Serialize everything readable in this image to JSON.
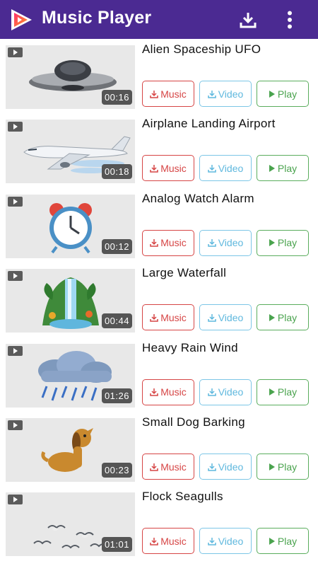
{
  "app": {
    "title": "Music Player"
  },
  "actions": {
    "music_label": "Music",
    "video_label": "Video",
    "play_label": "Play"
  },
  "items": [
    {
      "name": "Alien Spaceship UFO",
      "duration": "00:16",
      "art": "ufo"
    },
    {
      "name": "Airplane Landing Airport",
      "duration": "00:18",
      "art": "airplane"
    },
    {
      "name": "Analog Watch Alarm",
      "duration": "00:12",
      "art": "alarm-clock"
    },
    {
      "name": "Large Waterfall",
      "duration": "00:44",
      "art": "waterfall"
    },
    {
      "name": "Heavy Rain Wind",
      "duration": "01:26",
      "art": "rain-cloud"
    },
    {
      "name": "Small Dog Barking",
      "duration": "00:23",
      "art": "dog"
    },
    {
      "name": "Flock Seagulls",
      "duration": "01:01",
      "art": "seagulls"
    }
  ],
  "colors": {
    "appbar": "#4b2a92",
    "music": "#d64545",
    "video": "#5fb8de",
    "play": "#4aa34e"
  }
}
